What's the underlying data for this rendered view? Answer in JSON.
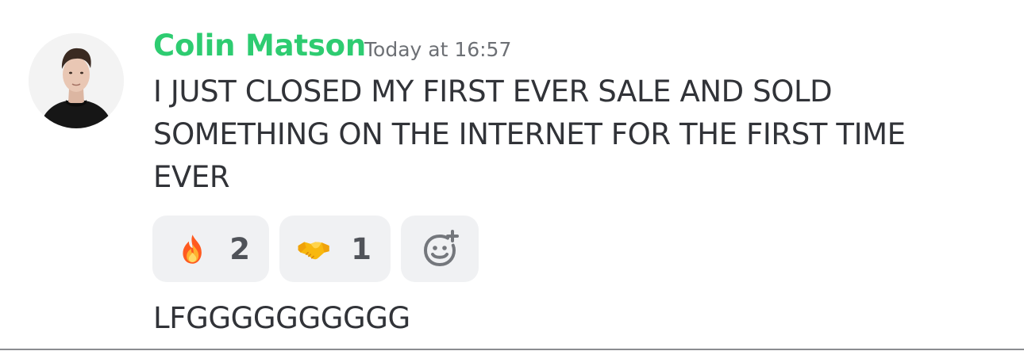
{
  "message": {
    "author": "Colin Matson",
    "timestamp": "Today at 16:57",
    "author_color": "#2ecc71",
    "text_lines": [
      "I JUST CLOSED MY FIRST EVER SALE AND SOLD",
      "SOMETHING ON THE INTERNET FOR THE FIRST TIME",
      "EVER"
    ],
    "reactions": [
      {
        "icon": "fire-emoji-icon",
        "count": "2"
      },
      {
        "icon": "handshake-emoji-icon",
        "count": "1"
      }
    ],
    "add_reaction_icon": "add-reaction-icon"
  },
  "followup_message": {
    "text": "LFGGGGGGGGGG"
  },
  "colors": {
    "background": "#ffffff",
    "text": "#313338",
    "muted": "#6d7075",
    "reaction_bg": "#f0f1f3"
  }
}
